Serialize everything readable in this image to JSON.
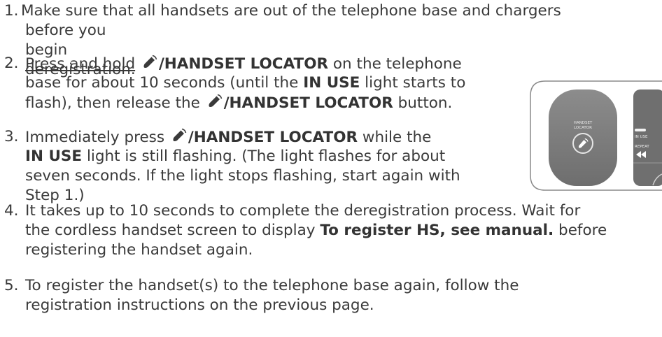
{
  "step1": {
    "num": "1.",
    "line1": "Make sure that all handsets are out of the telephone base and chargers",
    "line2": "before you begin deregistration."
  },
  "step2": {
    "num": "2.",
    "underlined": "Press and hold",
    "key": "/HANDSET LOCATOR",
    "after_key": " on the telephone",
    "line2_a": "base for about 10 seconds (until the ",
    "line2_bold": "IN USE",
    "line2_b": " light starts to",
    "line3_a": "flash), then release the ",
    "line3_key": "/HANDSET LOCATOR",
    "line3_b": " button."
  },
  "step3": {
    "num": "3.",
    "line1_a": "Immediately press ",
    "line1_key": "/HANDSET LOCATOR",
    "line1_b": " while the",
    "line2_bold": "IN USE",
    "line2_b": " light is still flashing. (The light flashes for about",
    "line3": "seven seconds. If the light stops flashing, start again with",
    "line4": "Step 1.)"
  },
  "step4": {
    "num": "4.",
    "line1": "It takes up to 10 seconds to complete the deregistration process. Wait for",
    "line2_a": "the cordless handset screen to display ",
    "line2_bold": "To register HS, see manual.",
    "line2_b": " before",
    "line3": "registering the handset again."
  },
  "step5": {
    "num": "5.",
    "line1": "To register the handset(s) to the telephone base again, follow the",
    "line2": "registration instructions on the previous page."
  },
  "illustration": {
    "locator_label_1": "HANDSET",
    "locator_label_2": "LOCATOR",
    "in_use_label": "IN USE",
    "repeat_label": "REPEAT",
    "icons": [
      "handset-locator-icon",
      "rewind-icon"
    ]
  }
}
